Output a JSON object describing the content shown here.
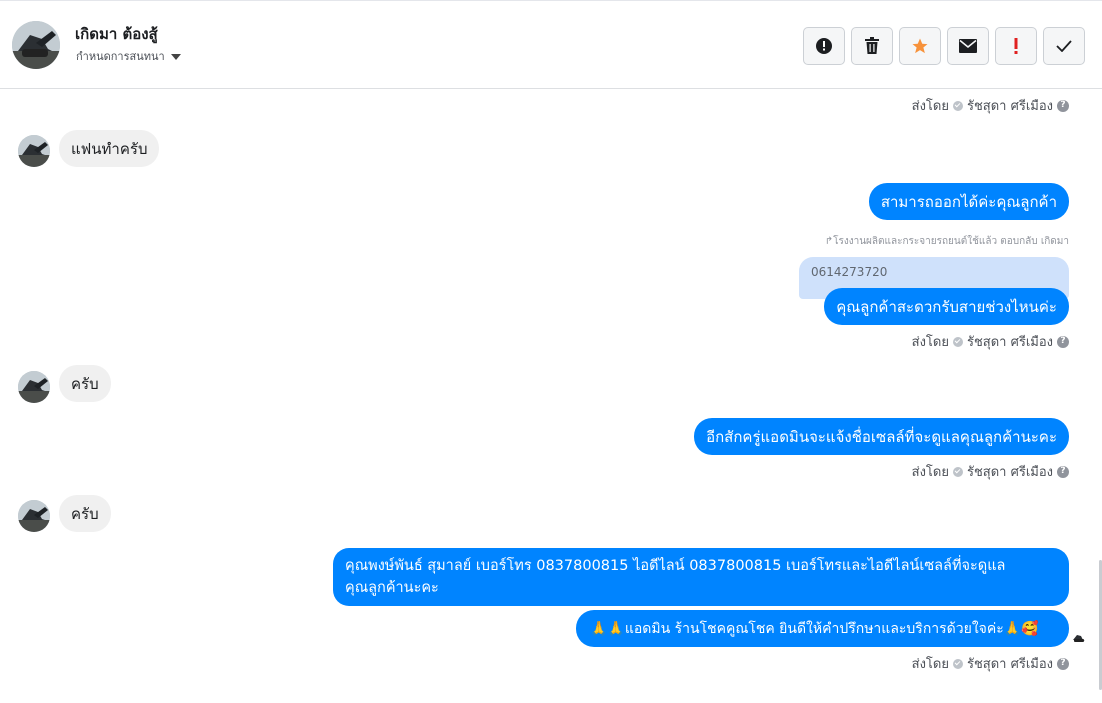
{
  "header": {
    "name": "เกิดมา ต้องสู้",
    "assign_label": "กำหนดการสนทนา",
    "toolbar": [
      {
        "name": "alert-button",
        "icon": "alert-circle-icon",
        "label": "!"
      },
      {
        "name": "delete-button",
        "icon": "trash-icon"
      },
      {
        "name": "star-button",
        "icon": "star-icon",
        "color": "#f7923b"
      },
      {
        "name": "mark-unread-button",
        "icon": "envelope-icon"
      },
      {
        "name": "important-button",
        "icon": "exclamation-icon",
        "label": "!",
        "color": "#e02020"
      },
      {
        "name": "done-button",
        "icon": "check-icon"
      }
    ]
  },
  "sent_by": {
    "prefix": "ส่งโดย",
    "name": "รัชสุดา ศรีเมือง",
    "help": "?"
  },
  "messages": {
    "in1": "แฟนทำครับ",
    "out1": "สามารถออกได้ค่ะคุณลูกค้า",
    "reply_note": "↱โรงงานผลิตและกระจายรถยนต์ใช้แล้ว ตอบกลับ เกิดมา",
    "quoted": "0614273720",
    "out2": "คุณลูกค้าสะดวกรับสายช่วงไหนค่ะ",
    "in2": "ครับ",
    "out3": "อีกสักครู่แอดมินจะแจ้งชื่อเซลล์ที่จะดูแลคุณลูกค้านะคะ",
    "in3": "ครับ",
    "out4_line1": "คุณพงษ์พันธ์ สุมาลย์      เบอร์โทร 0837800815  ไอดีไลน์ 0837800815   เบอร์โทรและไอดีไลน์เซลล์ที่จะดูแล",
    "out4_line2": "คุณลูกค้านะคะ",
    "out5": "🙏🙏แอดมิน ร้านโชคคูณโชค ยินดีให้คำปรึกษาและบริการด้วยใจค่ะ🙏🥰"
  },
  "colors": {
    "outgoing": "#0084ff",
    "incoming": "#f0f0f0",
    "quoted": "#cfe1fb"
  }
}
